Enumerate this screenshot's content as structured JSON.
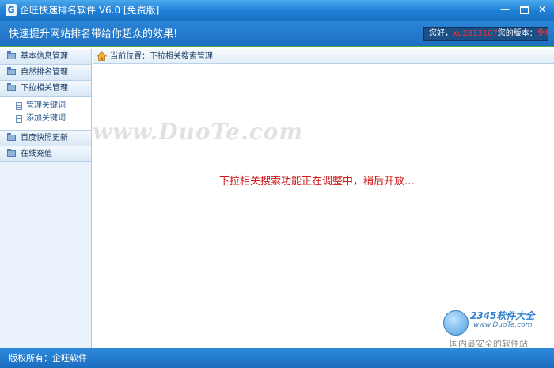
{
  "window": {
    "app_icon_glyph": "G",
    "title": "企旺快速排名软件 V6.0 [免费版]",
    "controls": {
      "minimize": "—",
      "close": "✕"
    }
  },
  "banner": {
    "slogan": "快速提升网站排名带给你超众的效果!",
    "user": {
      "greeting": "您好，",
      "username": "xu2813107",
      "version_label": "您的版本：",
      "version_value": "免费版"
    }
  },
  "sidebar": {
    "items": [
      {
        "label": "基本信息管理",
        "icon": "folder-icon"
      },
      {
        "label": "自然排名管理",
        "icon": "folder-icon"
      },
      {
        "label": "下拉相关管理",
        "icon": "folder-icon"
      },
      {
        "label": "百度快照更新",
        "icon": "folder-icon"
      },
      {
        "label": "在线充值",
        "icon": "folder-icon"
      }
    ],
    "subitems": [
      {
        "label": "管理关键词",
        "icon": "document-icon"
      },
      {
        "label": "添加关键词",
        "icon": "document-icon"
      }
    ]
  },
  "content": {
    "breadcrumb": {
      "icon": "home-icon",
      "text": "当前位置：下拉相关搜索管理"
    },
    "notice": "下拉相关搜索功能正在调整中，稍后开放...",
    "accent_color": "#d01818"
  },
  "watermarks": {
    "url_text": "www.DuoTe.com",
    "brand": "2345软件大全",
    "site": "www.DuoTe.com",
    "tagline": "国内最安全的软件站"
  },
  "statusbar": {
    "copyright": "版权所有：企旺软件"
  },
  "colors": {
    "titlebar": "#1e7fd6",
    "banner_border": "#4cae3d",
    "sidebar_bg": "#eaf3fb"
  }
}
